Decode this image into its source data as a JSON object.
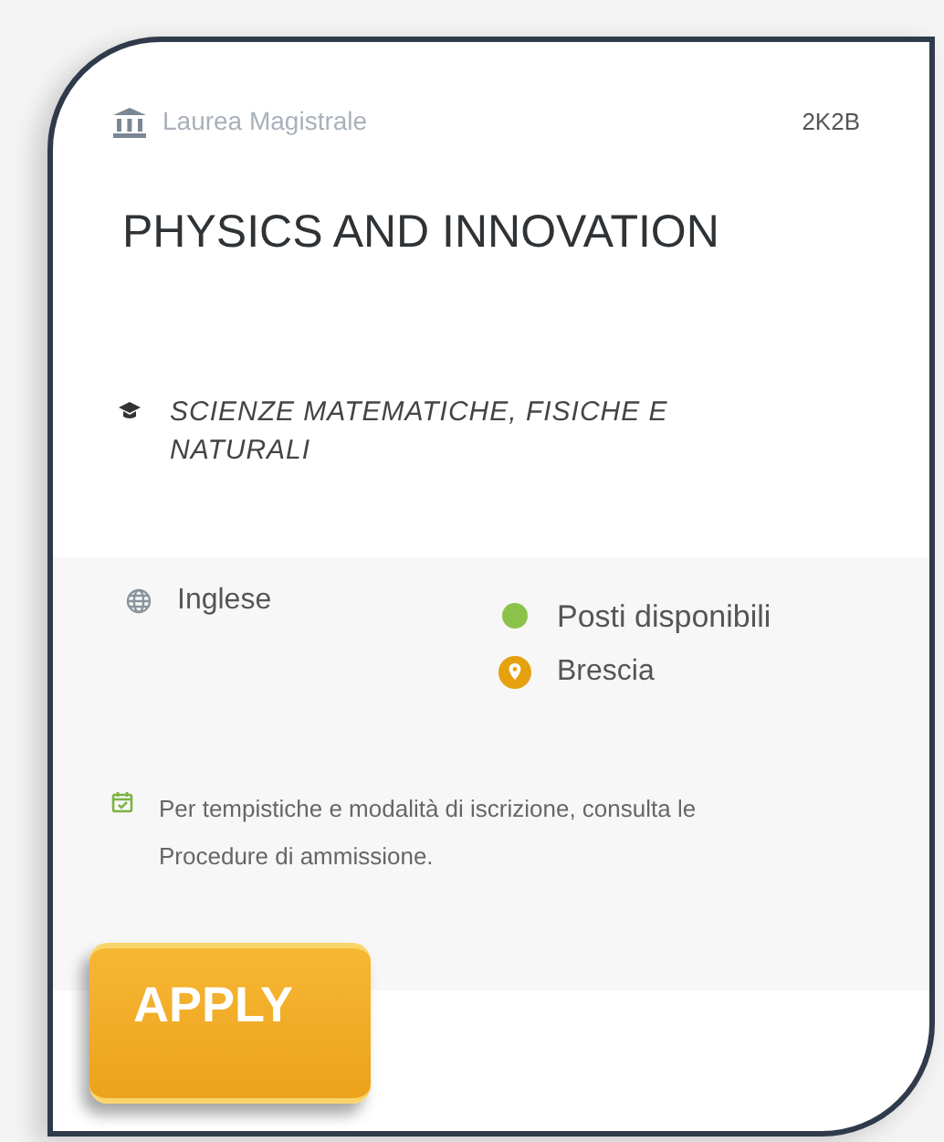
{
  "card": {
    "degree_type": "Laurea Magistrale",
    "code": "2K2B",
    "title": "PHYSICS AND INNOVATION",
    "faculty": "SCIENZE MATEMATICHE, FISICHE E NATURALI"
  },
  "details": {
    "language": "Inglese",
    "availability": {
      "label": "Posti disponibili",
      "color": "#8bc34a"
    },
    "location": "Brescia"
  },
  "note": "Per tempistiche e modalità di iscrizione, consulta le Procedure di ammissione.",
  "apply_button": "APPLY"
}
